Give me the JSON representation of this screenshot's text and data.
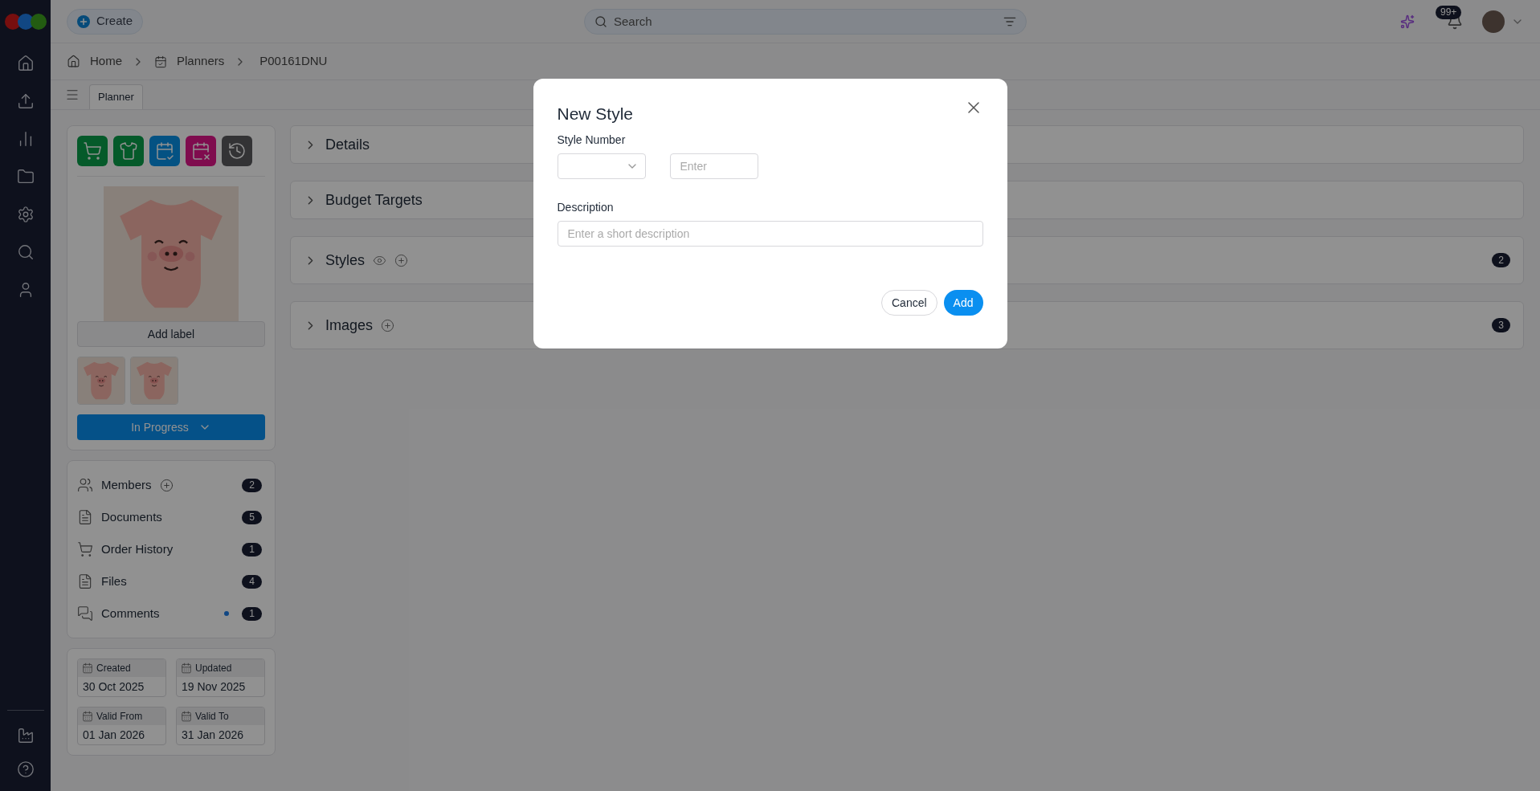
{
  "topbar": {
    "create_button": "Create",
    "search": {
      "placeholder": "Search"
    },
    "notifications": "99+"
  },
  "breadcrumb": [
    {
      "label": "Home"
    },
    {
      "label": "Planners"
    },
    {
      "label": "P00161DNU"
    }
  ],
  "tabs": [
    {
      "label": "Planner",
      "selected": true
    }
  ],
  "panel": {
    "actions": [
      {
        "kind": "cart"
      },
      {
        "kind": "shirt"
      },
      {
        "kind": "calendars"
      },
      {
        "kind": "calendar-x"
      },
      {
        "kind": "history"
      }
    ],
    "add_label": "Add label",
    "status": "In Progress"
  },
  "links": [
    {
      "kind": "members",
      "label": "Members",
      "count": "2",
      "addable": true,
      "unread": false
    },
    {
      "kind": "documents",
      "label": "Documents",
      "count": "5",
      "addable": false,
      "unread": false
    },
    {
      "kind": "orders",
      "label": "Order History",
      "count": "1",
      "addable": false,
      "unread": false
    },
    {
      "kind": "files",
      "label": "Files",
      "count": "4",
      "addable": false,
      "unread": false
    },
    {
      "kind": "comments",
      "label": "Comments",
      "count": "1",
      "addable": false,
      "unread": true
    }
  ],
  "dates": [
    {
      "label": "Created",
      "value": "30 Oct 2025"
    },
    {
      "label": "Updated",
      "value": "19 Nov 2025"
    },
    {
      "label": "Valid From",
      "value": "01 Jan 2026"
    },
    {
      "label": "Valid To",
      "value": "31 Jan 2026"
    }
  ],
  "sections": [
    {
      "title": "Details",
      "expanded": false,
      "viewable": false,
      "addable": false
    },
    {
      "title": "Budget Targets",
      "expanded": false,
      "viewable": false,
      "addable": false
    },
    {
      "title": "Styles",
      "expanded": false,
      "viewable": true,
      "addable": true,
      "count": "2"
    },
    {
      "title": "Images",
      "expanded": false,
      "viewable": false,
      "addable": true,
      "count": "3"
    }
  ],
  "dialog": {
    "title": "New Style",
    "style_number": {
      "label": "Style Number",
      "input_placeholder": "Enter"
    },
    "description": {
      "label": "Description",
      "placeholder": "Enter a short description"
    },
    "buttons": {
      "cancel": "Cancel",
      "add": "Add"
    }
  }
}
